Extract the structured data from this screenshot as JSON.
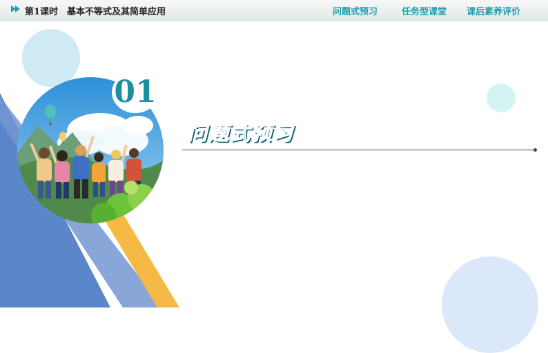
{
  "header": {
    "lesson": "第1课时",
    "title": "基本不等式及其简单应用",
    "nav": [
      "问题式预习",
      "任务型课堂",
      "课后素养评价"
    ]
  },
  "section": {
    "number": "01",
    "title": "问题式预习"
  },
  "colors": {
    "accent": "#1f9dad",
    "blue_triangle": "#5b86c9",
    "orange_stripe": "#f7b945",
    "light_circle": "#cfe9f5"
  },
  "illustration": {
    "description_icon": "group-of-friends-celebrating-icon"
  }
}
